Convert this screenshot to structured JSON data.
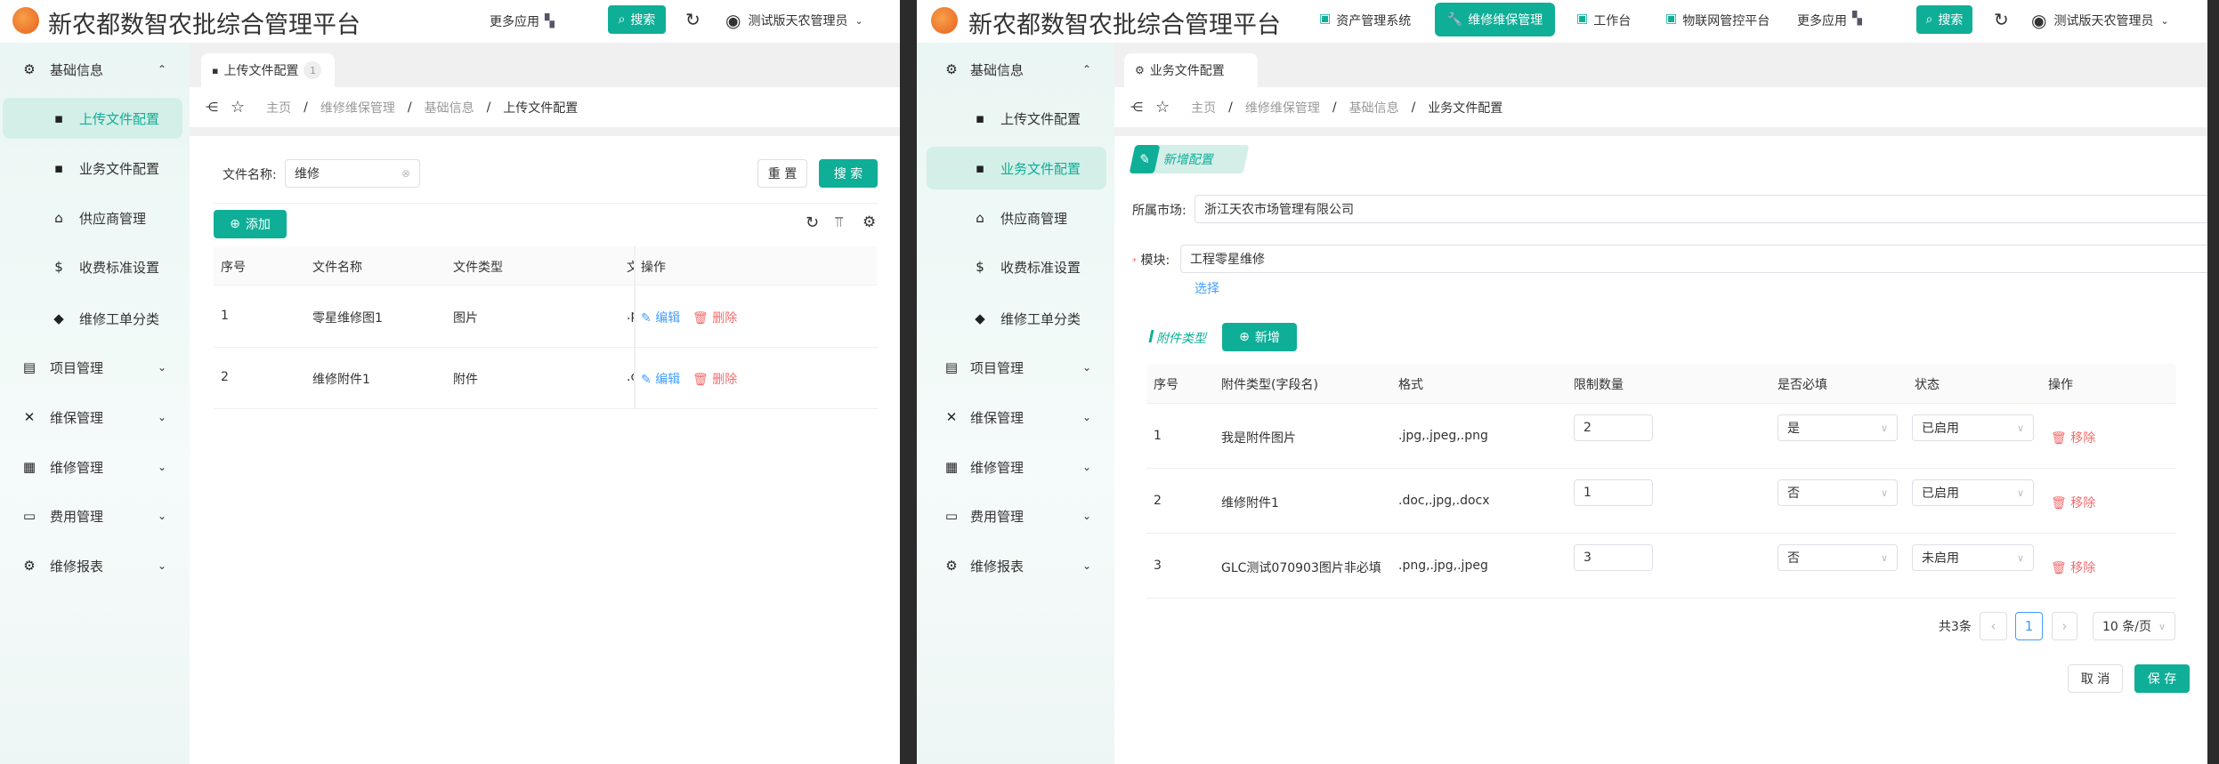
{
  "app_title": "新农都数智农批综合管理平台",
  "header": {
    "more_apps": "更多应用",
    "search": "搜索",
    "user": "测试版天农管理员",
    "nav": [
      {
        "label": "资产管理系统"
      },
      {
        "label": "维修维保管理",
        "active": true
      },
      {
        "label": "工作台"
      },
      {
        "label": "物联网管控平台"
      }
    ]
  },
  "sidebar": {
    "groups": [
      {
        "label": "基础信息",
        "expanded": true,
        "items": [
          "上传文件配置",
          "业务文件配置",
          "供应商管理",
          "收费标准设置",
          "维修工单分类"
        ]
      },
      {
        "label": "项目管理"
      },
      {
        "label": "维保管理"
      },
      {
        "label": "维修管理"
      },
      {
        "label": "费用管理"
      },
      {
        "label": "维修报表"
      }
    ]
  },
  "left": {
    "tab": {
      "label": "上传文件配置",
      "count": "1"
    },
    "breadcrumb": [
      "主页",
      "维修维保管理",
      "基础信息",
      "上传文件配置"
    ],
    "filter": {
      "label": "文件名称:",
      "value": "维修",
      "reset": "重 置",
      "search": "搜 索"
    },
    "add": "添加",
    "table": {
      "headers": [
        "序号",
        "文件名称",
        "文件类型",
        "文",
        "操作"
      ],
      "rows": [
        {
          "no": "1",
          "name": "零星维修图1",
          "type": "图片",
          "ext": ".p",
          "edit": "编辑",
          "del": "删除"
        },
        {
          "no": "2",
          "name": "维修附件1",
          "type": "附件",
          "ext": ".c",
          "edit": "编辑",
          "del": "删除"
        }
      ]
    }
  },
  "right": {
    "tab": {
      "label": "业务文件配置"
    },
    "breadcrumb": [
      "主页",
      "维修维保管理",
      "基础信息",
      "业务文件配置"
    ],
    "section_badge": "新增配置",
    "market": {
      "label": "所属市场:",
      "value": "浙江天农市场管理有限公司"
    },
    "module": {
      "label": "模块:",
      "required": "*",
      "value": "工程零星维修",
      "select_link": "选择"
    },
    "attach": {
      "title": "附件类型",
      "add": "新增"
    },
    "table": {
      "headers": [
        "序号",
        "附件类型(字段名)",
        "格式",
        "限制数量",
        "是否必填",
        "状态",
        "操作"
      ],
      "rows": [
        {
          "no": "1",
          "name": "我是附件图片",
          "fmt": ".jpg,.jpeg,.png",
          "limit": "2",
          "required": "是",
          "status": "已启用",
          "action": "移除"
        },
        {
          "no": "2",
          "name": "维修附件1",
          "fmt": ".doc,.jpg,.docx",
          "limit": "1",
          "required": "否",
          "status": "已启用",
          "action": "移除"
        },
        {
          "no": "3",
          "name": "GLC测试070903图片非必填",
          "fmt": ".png,.jpg,.jpeg",
          "limit": "3",
          "required": "否",
          "status": "未启用",
          "action": "移除"
        }
      ]
    },
    "pagination": {
      "total": "共3条",
      "page": "1",
      "size": "10 条/页"
    },
    "cancel": "取 消",
    "save": "保 存"
  },
  "colors": {
    "accent": "#0fae97",
    "danger": "#f56c6c",
    "link": "#409eff"
  }
}
